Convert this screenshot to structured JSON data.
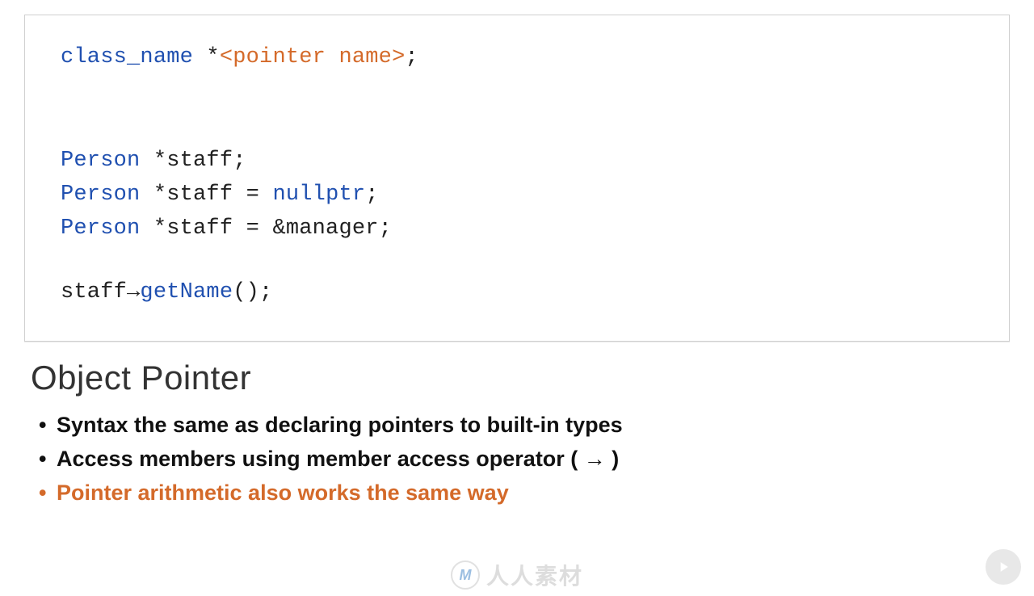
{
  "code": {
    "line1": {
      "a": "class_name",
      "b": " *",
      "c": "<pointer name>",
      "d": ";"
    },
    "line2": {
      "a": "Person",
      "b": " *staff;"
    },
    "line3": {
      "a": "Person",
      "b": " *staff = ",
      "c": "nullptr",
      "d": ";"
    },
    "line4": {
      "a": "Person",
      "b": " *staff = &manager;"
    },
    "line5": {
      "a": "staff→",
      "b": "getName",
      "c": "();"
    }
  },
  "section_title": "Object Pointer",
  "bullets": {
    "b1": "Syntax the same as declaring pointers to built-in types",
    "b2": "Access members using member access operator ( → )",
    "b3": "Pointer arithmetic also works the same way"
  },
  "watermark": {
    "badge": "M",
    "text": "人人素材"
  }
}
